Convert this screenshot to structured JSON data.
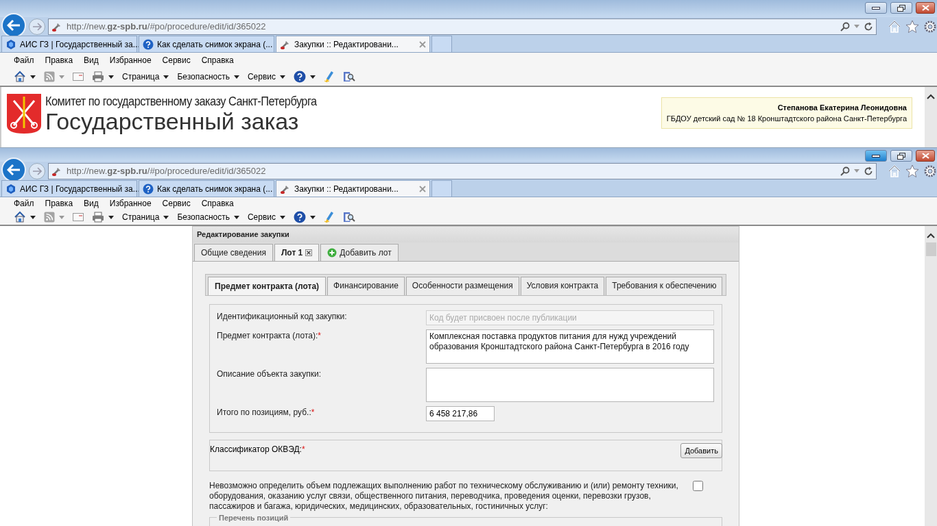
{
  "windows": [
    {
      "minimize_highlighted": false,
      "url": "http://new.**gz-spb.ru**/#po/procedure/edit/id/365022",
      "tabs": [
        {
          "label": "АИС ГЗ | Государственный за...",
          "selected": false,
          "kind": "site"
        },
        {
          "label": "Как сделать снимок экрана (...",
          "selected": false,
          "kind": "help"
        },
        {
          "label": "Закупки :: Редактировани...",
          "selected": true,
          "kind": "tool"
        }
      ],
      "menu": [
        "Файл",
        "Правка",
        "Вид",
        "Избранное",
        "Сервис",
        "Справка"
      ],
      "command_bar": [
        {
          "kind": "home",
          "dropdown": true,
          "disabled": false
        },
        {
          "kind": "feeds",
          "dropdown": true,
          "disabled": true
        },
        {
          "kind": "mail",
          "dropdown": false,
          "disabled": false
        },
        {
          "kind": "print",
          "dropdown": true,
          "disabled": false
        },
        {
          "kind": "menu",
          "label": "Страница",
          "dropdown": true,
          "disabled": false
        },
        {
          "kind": "menu",
          "label": "Безопасность",
          "dropdown": true,
          "disabled": false
        },
        {
          "kind": "menu",
          "label": "Сервис",
          "dropdown": true,
          "disabled": false
        },
        {
          "kind": "help",
          "dropdown": true,
          "disabled": false
        },
        {
          "kind": "pen",
          "dropdown": false,
          "disabled": false
        },
        {
          "kind": "research",
          "dropdown": false,
          "disabled": false
        }
      ],
      "page": {
        "kind": "header",
        "org": "Комитет по государственному заказу Санкт-Петербурга",
        "title": "Государственный заказ",
        "user_name": "Степанова Екатерина Леонидовна",
        "user_org": "ГБДОУ детский сад № 18 Кронштадтского района Санкт-Петербурга"
      }
    },
    {
      "minimize_highlighted": true,
      "url": "http://new.**gz-spb.ru**/#po/procedure/edit/id/365022",
      "tabs": [
        {
          "label": "АИС ГЗ | Государственный за...",
          "selected": false,
          "kind": "site"
        },
        {
          "label": "Как сделать снимок экрана (...",
          "selected": false,
          "kind": "help"
        },
        {
          "label": "Закупки :: Редактировани...",
          "selected": true,
          "kind": "tool"
        }
      ],
      "menu": [
        "Файл",
        "Правка",
        "Вид",
        "Избранное",
        "Сервис",
        "Справка"
      ],
      "command_bar": [
        {
          "kind": "home",
          "dropdown": true,
          "disabled": false
        },
        {
          "kind": "feeds",
          "dropdown": true,
          "disabled": true
        },
        {
          "kind": "mail",
          "dropdown": false,
          "disabled": false
        },
        {
          "kind": "print",
          "dropdown": true,
          "disabled": false
        },
        {
          "kind": "menu",
          "label": "Страница",
          "dropdown": true,
          "disabled": false
        },
        {
          "kind": "menu",
          "label": "Безопасность",
          "dropdown": true,
          "disabled": false
        },
        {
          "kind": "menu",
          "label": "Сервис",
          "dropdown": true,
          "disabled": false
        },
        {
          "kind": "help",
          "dropdown": true,
          "disabled": false
        },
        {
          "kind": "pen",
          "dropdown": false,
          "disabled": false
        },
        {
          "kind": "research",
          "dropdown": false,
          "disabled": false
        }
      ],
      "page": {
        "kind": "form",
        "panel_title": "Редактирование закупки",
        "tabs": [
          {
            "label": "Общие сведения",
            "selected": false,
            "kind": "plain"
          },
          {
            "label": "Лот 1",
            "selected": true,
            "kind": "closable"
          },
          {
            "label": "Добавить лот",
            "selected": false,
            "kind": "add"
          }
        ],
        "subtabs": [
          {
            "label": "Предмет контракта (лота)",
            "selected": true
          },
          {
            "label": "Финансирование",
            "selected": false
          },
          {
            "label": "Особенности размещения",
            "selected": false
          },
          {
            "label": "Условия контракта",
            "selected": false
          },
          {
            "label": "Требования к обеспечению",
            "selected": false
          }
        ],
        "fields": [
          {
            "label": "Идентификационный код закупки:",
            "kind": "readonly",
            "placeholder": "Код будет присвоен после публикации"
          },
          {
            "label": "Предмет контракта (лота):",
            "required_mark": "*",
            "kind": "textarea",
            "value": "Комплексная поставка продуктов питания для нужд учреждений образования Кронштадтского района Санкт-Петербурга в 2016 году"
          },
          {
            "label": "Описание объекта закупки:",
            "kind": "textarea"
          },
          {
            "label": "Итого по позициям, руб.:",
            "required_mark": "*",
            "kind": "input",
            "value": "6 458 217,86"
          }
        ],
        "classifier": {
          "label": "Классификатор ОКВЭД:",
          "required_mark": "*",
          "button": "Добавить"
        },
        "notice": {
          "text": "Невозможно определить объем подлежащих выполнению работ по техническому обслуживанию и (или) ремонту техники, оборудования, оказанию услуг связи, общественного питания, переводчика, проведения оценки, перевозки грузов, пассажиров и багажа, юридических, медицинских, образовательных, гостиничных услуг:",
          "checked": false
        },
        "positions_legend": "Перечень позиций"
      }
    }
  ]
}
